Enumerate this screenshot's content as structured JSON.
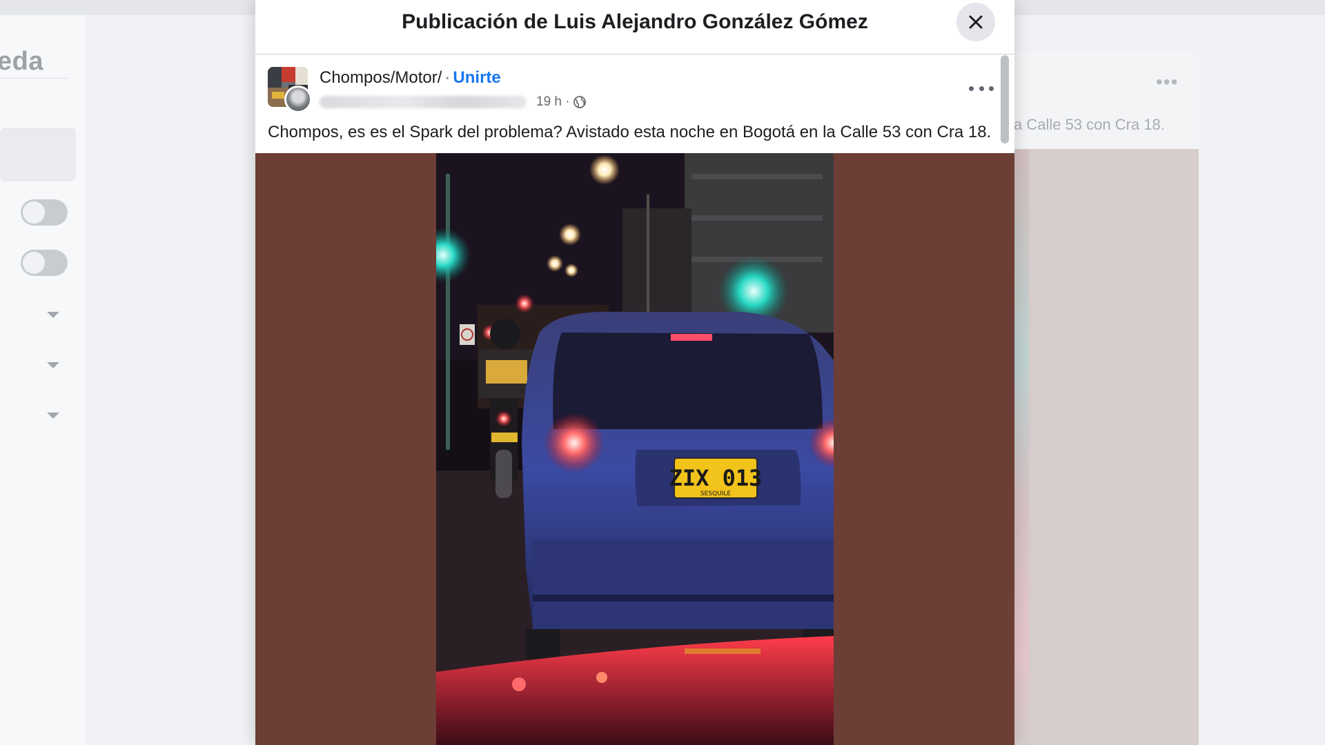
{
  "modal": {
    "title": "Publicación de Luis Alejandro González Gómez",
    "close_icon": "close-icon"
  },
  "post": {
    "group_name": "Chompos/Motor/",
    "separator": "·",
    "join_label": "Unirte",
    "time": "19 h ·",
    "privacy_icon": "globe-icon",
    "more_icon": "more-horizontal-icon",
    "text": "Chompos, es es el Spark del problema? Avistado esta noche en Bogotá en la Calle 53 con Cra 18.",
    "photo": {
      "plate_number": "ZIX 013",
      "plate_city": "SESQUILE"
    }
  },
  "background": {
    "left_title": "eda",
    "card_text": "a Calle 53 con Cra 18."
  },
  "colors": {
    "accent": "#1877f2",
    "photo_backdrop": "#6c3e36",
    "modal_bg": "#ffffff"
  }
}
